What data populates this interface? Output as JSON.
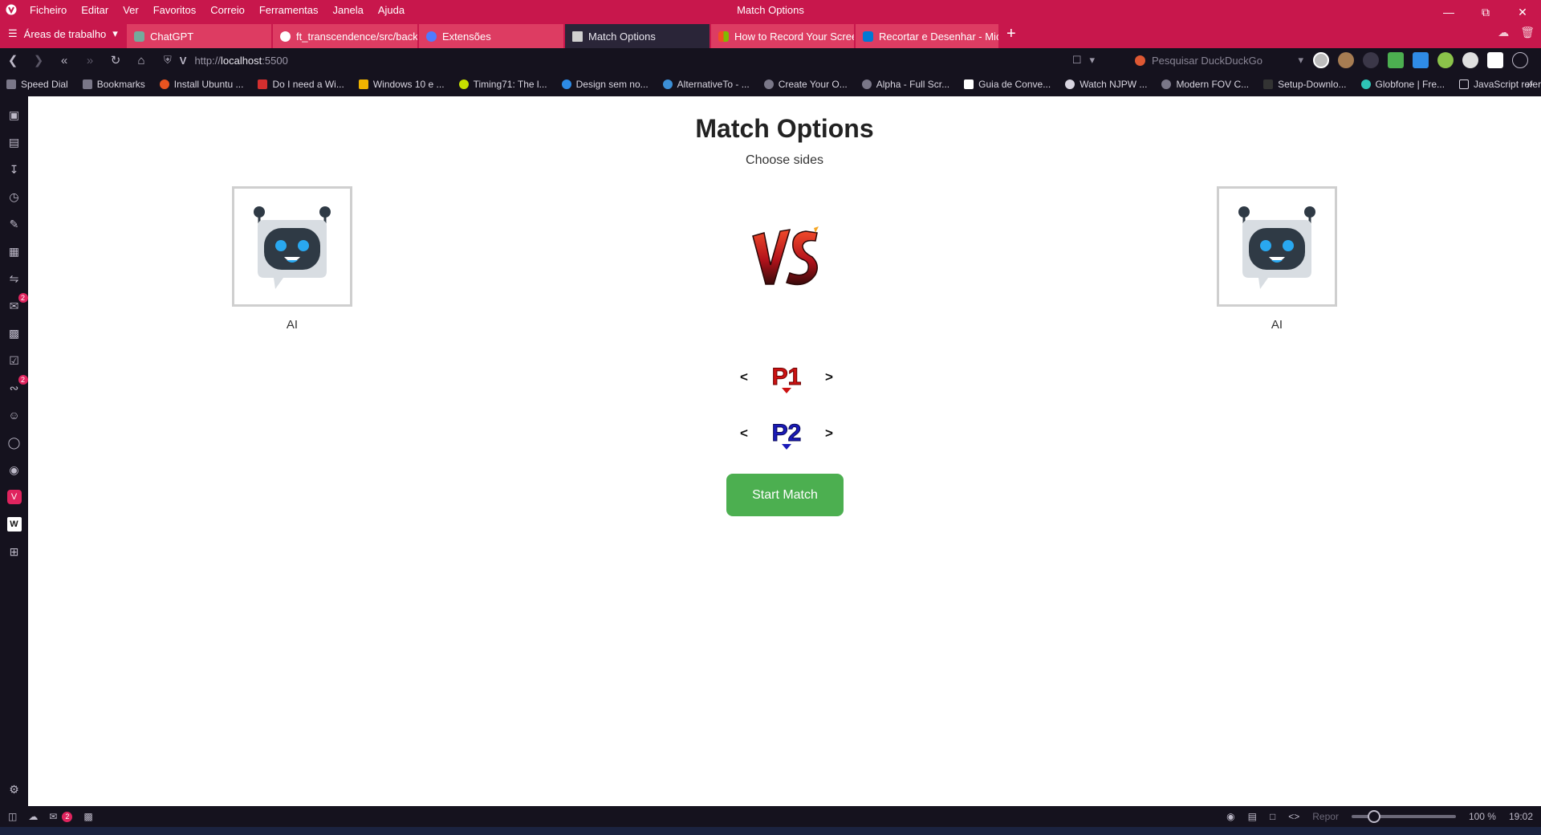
{
  "window": {
    "title": "Match Options",
    "menu": [
      "Ficheiro",
      "Editar",
      "Ver",
      "Favoritos",
      "Correio",
      "Ferramentas",
      "Janela",
      "Ajuda"
    ]
  },
  "tabs": {
    "workspaces_label": "Áreas de trabalho",
    "items": [
      {
        "label": "ChatGPT",
        "color": "#74aa9c"
      },
      {
        "label": "ft_transcendence/src/backe",
        "color": "#ffffff"
      },
      {
        "label": "Extensões",
        "color": "#4f7bff"
      },
      {
        "label": "Match Options",
        "color": "#d0d0d0"
      },
      {
        "label": "How to Record Your Screen",
        "color": "#f25022"
      },
      {
        "label": "Recortar e Desenhar - Micro",
        "color": "#0078d4"
      }
    ],
    "new_tab": "+"
  },
  "address": {
    "url_prefix": "http://",
    "url_host": "localhost",
    "url_port": ":5500",
    "search_placeholder": "Pesquisar DuckDuckGo"
  },
  "bookmarks": [
    "Speed Dial",
    "Bookmarks",
    "Install Ubuntu ...",
    "Do I need a Wi...",
    "Windows 10 e ...",
    "Timing71: The l...",
    "Design sem no...",
    "AlternativeTo - ...",
    "Create Your O...",
    "Alpha - Full Scr...",
    "Guia de Conve...",
    "Watch NJPW ...",
    "Modern FOV C...",
    "Setup-Downlo...",
    "Globfone | Fre...",
    "JavaScript refer..."
  ],
  "sidepanel": {
    "mail_badge": "2",
    "feeds_badge": "2"
  },
  "page": {
    "title": "Match Options",
    "subtitle": "Choose sides",
    "left_player": {
      "name": "AI"
    },
    "right_player": {
      "name": "AI"
    },
    "p1_selector": {
      "prev": "<",
      "next": ">",
      "label": "P1",
      "color": "#cc1111"
    },
    "p2_selector": {
      "prev": "<",
      "next": ">",
      "label": "P2",
      "color": "#1a1ab8"
    },
    "start_button": "Start Match"
  },
  "statusbar": {
    "mail_badge": "2",
    "reset_label": "Repor",
    "zoom": "100 %",
    "time": "19:02"
  }
}
